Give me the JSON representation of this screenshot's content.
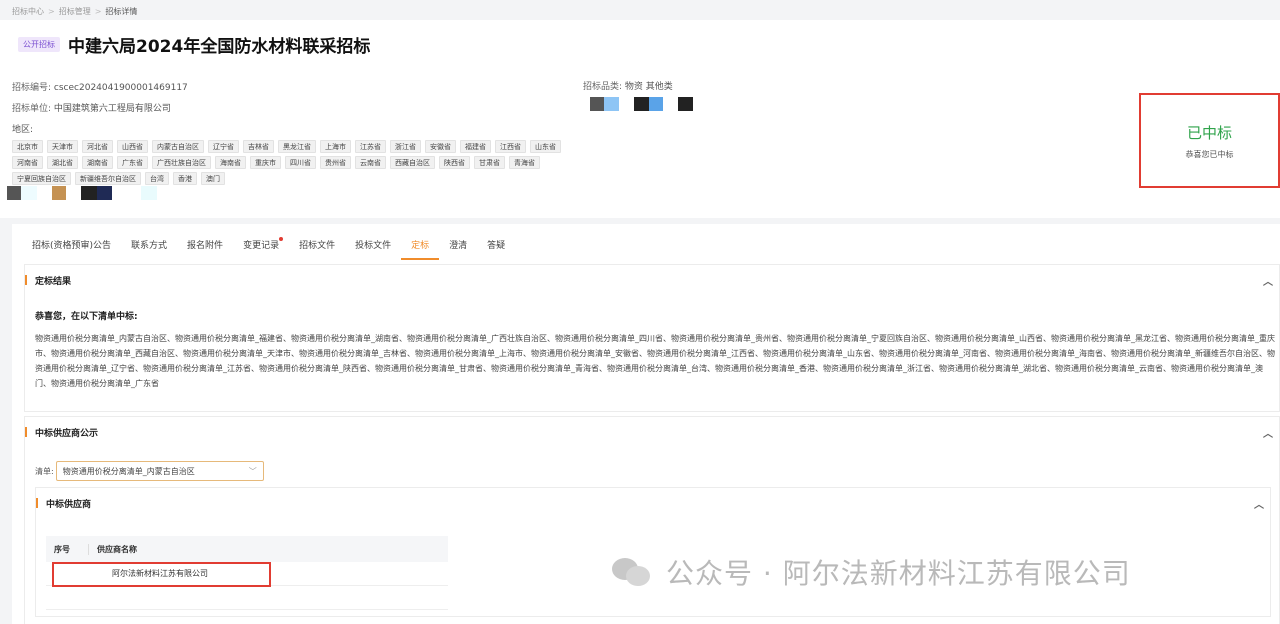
{
  "breadcrumb": [
    "招标中心",
    "招标管理",
    "招标详情"
  ],
  "header": {
    "badge": "公开招标",
    "title": "中建六局2024年全国防水材料联采招标",
    "bid_no_label": "招标编号:",
    "bid_no": "cscec2024041900001469117",
    "unit_label": "招标单位:",
    "unit": "中国建筑第六工程局有限公司",
    "region_label": "地区:",
    "category_label": "招标品类:",
    "category": "物资 其他类"
  },
  "regions": [
    "北京市",
    "天津市",
    "河北省",
    "山西省",
    "内蒙古自治区",
    "辽宁省",
    "吉林省",
    "黑龙江省",
    "上海市",
    "江苏省",
    "浙江省",
    "安徽省",
    "福建省",
    "江西省",
    "山东省",
    "河南省",
    "湖北省",
    "湖南省",
    "广东省",
    "广西壮族自治区",
    "海南省",
    "重庆市",
    "四川省",
    "贵州省",
    "云南省",
    "西藏自治区",
    "陕西省",
    "甘肃省",
    "青海省",
    "宁夏回族自治区",
    "新疆维吾尔自治区",
    "台湾",
    "香港",
    "澳门"
  ],
  "status": {
    "main": "已中标",
    "sub": "恭喜您已中标"
  },
  "tabs": [
    "招标(资格预审)公告",
    "联系方式",
    "报名附件",
    "变更记录",
    "招标文件",
    "投标文件",
    "定标",
    "澄清",
    "答疑"
  ],
  "section_result": {
    "title": "定标结果",
    "congrats": "恭喜您，在以下清单中标:",
    "text": "物资通用价税分离清单_内蒙古自治区、物资通用价税分离清单_福建省、物资通用价税分离清单_湖南省、物资通用价税分离清单_广西壮族自治区、物资通用价税分离清单_四川省、物资通用价税分离清单_贵州省、物资通用价税分离清单_宁夏回族自治区、物资通用价税分离清单_山西省、物资通用价税分离清单_黑龙江省、物资通用价税分离清单_重庆市、物资通用价税分离清单_西藏自治区、物资通用价税分离清单_天津市、物资通用价税分离清单_吉林省、物资通用价税分离清单_上海市、物资通用价税分离清单_安徽省、物资通用价税分离清单_江西省、物资通用价税分离清单_山东省、物资通用价税分离清单_河南省、物资通用价税分离清单_海南省、物资通用价税分离清单_新疆维吾尔自治区、物资通用价税分离清单_辽宁省、物资通用价税分离清单_江苏省、物资通用价税分离清单_陕西省、物资通用价税分离清单_甘肃省、物资通用价税分离清单_青海省、物资通用价税分离清单_台湾、物资通用价税分离清单_香港、物资通用价税分离清单_浙江省、物资通用价税分离清单_湖北省、物资通用价税分离清单_云南省、物资通用价税分离清单_澳门、物资通用价税分离清单_广东省"
  },
  "section_supplier": {
    "title": "中标供应商公示",
    "list_label": "清单:",
    "list_value": "物资通用价税分离清单_内蒙古自治区",
    "sub_title": "中标供应商",
    "col_no": "序号",
    "col_name": "供应商名称",
    "rows": [
      {
        "no": "",
        "name": "阿尔法新材料江苏有限公司"
      }
    ]
  },
  "watermark": "公众号 · 阿尔法新材料江苏有限公司",
  "colors": {
    "accent": "#f08c2b",
    "success": "#2fa34b",
    "highlight": "#e13c32",
    "badge": "#7b4fd1"
  }
}
